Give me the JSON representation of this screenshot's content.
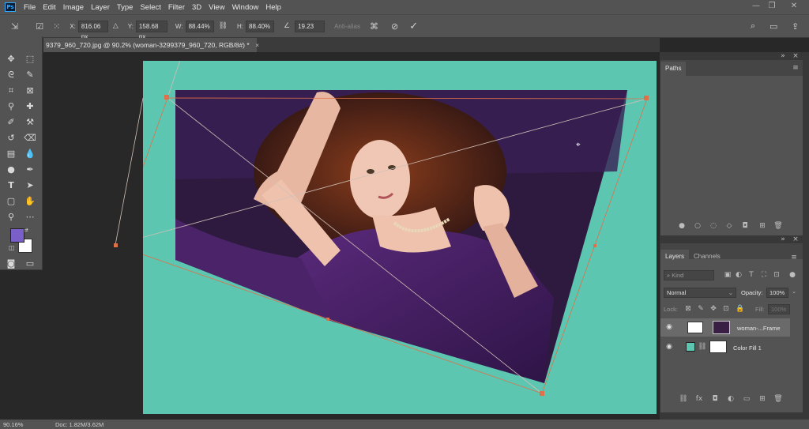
{
  "app": {
    "logo": "Ps"
  },
  "menu": [
    "File",
    "Edit",
    "Image",
    "Layer",
    "Type",
    "Select",
    "Filter",
    "3D",
    "View",
    "Window",
    "Help"
  ],
  "window_controls": {
    "minimize": "—",
    "restore": "❐",
    "close": "✕"
  },
  "options": {
    "x_label": "X:",
    "x_value": "816.06 px",
    "y_label": "Y:",
    "y_value": "158.68 px",
    "w_label": "W:",
    "w_value": "88.44%",
    "h_label": "H:",
    "h_value": "88.40%",
    "angle_value": "19.23",
    "antialias": "Anti-alias"
  },
  "document_tab": {
    "title": "9379_960_720.jpg @ 90.2% (woman-3299379_960_720, RGB/8#) *",
    "close": "×"
  },
  "panels": {
    "paths": {
      "title": "Paths"
    },
    "layers": {
      "tab_layers": "Layers",
      "tab_channels": "Channels",
      "filter_placeholder": "Kind",
      "blend_mode": "Normal",
      "opacity_label": "Opacity:",
      "opacity_value": "100%",
      "lock_label": "Lock:",
      "fill_label": "Fill:",
      "fill_value": "100%",
      "items": [
        {
          "name": "woman-...Frame"
        },
        {
          "name": "Color Fill 1"
        }
      ]
    }
  },
  "status": {
    "zoom": "90.16%",
    "doc": "Doc: 1.82M/3.62M"
  },
  "colors": {
    "foreground": "#7a5fc8",
    "background": "#ffffff",
    "canvas": "#5cc6b0"
  }
}
